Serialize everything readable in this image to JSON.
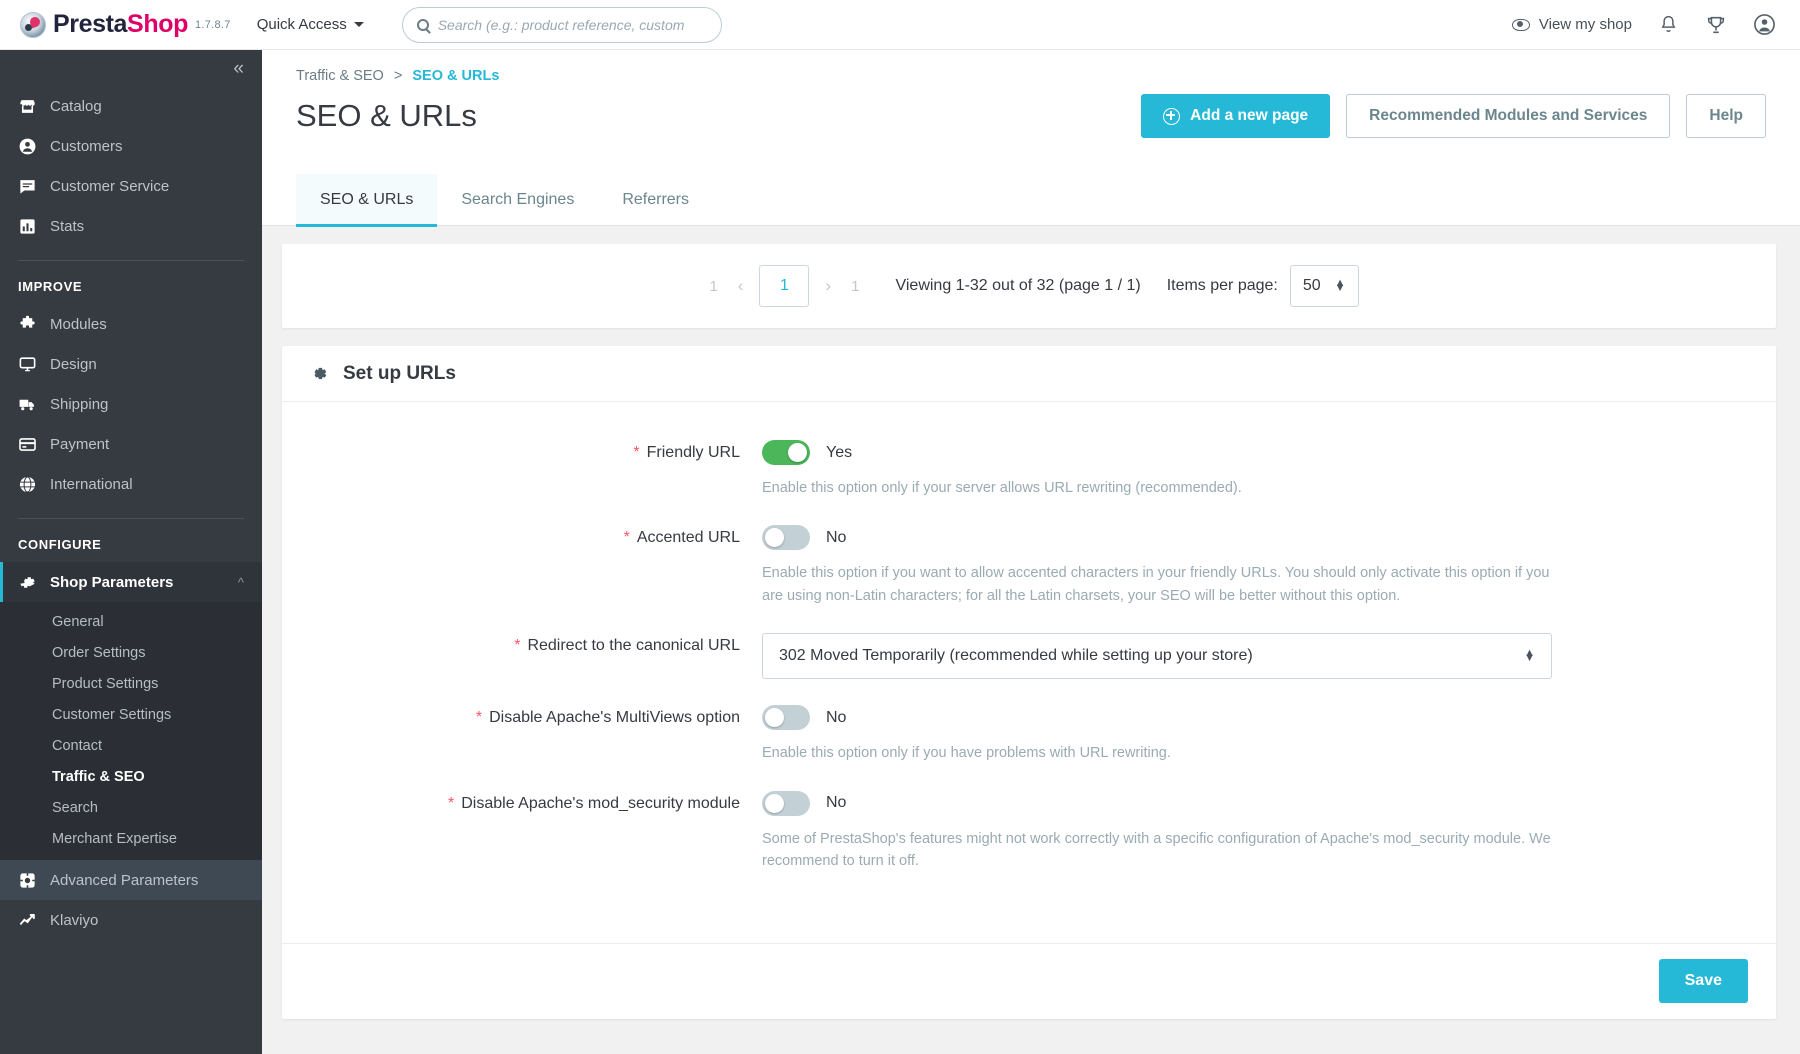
{
  "topbar": {
    "brand_a": "Presta",
    "brand_b": "Shop",
    "version": "1.7.8.7",
    "quick_access": "Quick Access",
    "search_placeholder": "Search (e.g.: product reference, custom",
    "search_value": "",
    "view_shop": "View my shop",
    "icons": [
      "eye-icon",
      "bell-icon",
      "trophy-icon",
      "account-icon"
    ]
  },
  "sidebar": {
    "collapse_glyph": "«",
    "groups": [
      {
        "title": null,
        "items": [
          {
            "label": "Catalog",
            "icon": "store-icon",
            "active": false
          },
          {
            "label": "Customers",
            "icon": "person-icon",
            "active": false
          },
          {
            "label": "Customer Service",
            "icon": "chat-icon",
            "active": false
          },
          {
            "label": "Stats",
            "icon": "bar-chart-icon",
            "active": false
          }
        ]
      },
      {
        "title": "IMPROVE",
        "items": [
          {
            "label": "Modules",
            "icon": "puzzle-icon",
            "active": false
          },
          {
            "label": "Design",
            "icon": "monitor-icon",
            "active": false
          },
          {
            "label": "Shipping",
            "icon": "truck-icon",
            "active": false
          },
          {
            "label": "Payment",
            "icon": "credit-card-icon",
            "active": false
          },
          {
            "label": "International",
            "icon": "globe-icon",
            "active": false
          }
        ]
      },
      {
        "title": "CONFIGURE",
        "items": [
          {
            "label": "Shop Parameters",
            "icon": "gear-icon",
            "active": true,
            "expanded": true
          },
          {
            "label": "Advanced Parameters",
            "icon": "sliders-icon",
            "active": false
          },
          {
            "label": "Klaviyo",
            "icon": "trend-icon",
            "active": false
          }
        ]
      }
    ],
    "submenu": [
      {
        "label": "General",
        "active": false
      },
      {
        "label": "Order Settings",
        "active": false
      },
      {
        "label": "Product Settings",
        "active": false
      },
      {
        "label": "Customer Settings",
        "active": false
      },
      {
        "label": "Contact",
        "active": false
      },
      {
        "label": "Traffic & SEO",
        "active": true
      },
      {
        "label": "Search",
        "active": false
      },
      {
        "label": "Merchant Expertise",
        "active": false
      }
    ]
  },
  "header": {
    "breadcrumb_parent": "Traffic & SEO",
    "breadcrumb_sep": ">",
    "breadcrumb_current": "SEO & URLs",
    "title": "SEO & URLs",
    "add_button": "Add a new page",
    "recommended_button": "Recommended Modules and Services",
    "help_button": "Help"
  },
  "tabs": [
    {
      "label": "SEO & URLs",
      "active": true
    },
    {
      "label": "Search Engines",
      "active": false
    },
    {
      "label": "Referrers",
      "active": false
    }
  ],
  "pagination": {
    "first": "1",
    "prev": "‹",
    "current": "1",
    "next": "›",
    "last": "1",
    "viewing": "Viewing 1-32 out of 32 (page 1 / 1)",
    "items_per_page_label": "Items per page:",
    "items_per_page_value": "50"
  },
  "panel": {
    "icon": "gear-icon",
    "title": "Set up URLs",
    "fields": [
      {
        "required": true,
        "label": "Friendly URL",
        "type": "toggle",
        "state": "on",
        "value_text": "Yes",
        "help": "Enable this option only if your server allows URL rewriting (recommended)."
      },
      {
        "required": true,
        "label": "Accented URL",
        "type": "toggle",
        "state": "off",
        "value_text": "No",
        "help": "Enable this option if you want to allow accented characters in your friendly URLs. You should only activate this option if you are using non-Latin characters; for all the Latin charsets, your SEO will be better without this option."
      },
      {
        "required": true,
        "label": "Redirect to the canonical URL",
        "type": "select",
        "value_text": "302 Moved Temporarily (recommended while setting up your store)",
        "help": ""
      },
      {
        "required": true,
        "label": "Disable Apache's MultiViews option",
        "type": "toggle",
        "state": "off",
        "value_text": "No",
        "help": "Enable this option only if you have problems with URL rewriting."
      },
      {
        "required": true,
        "label": "Disable Apache's mod_security module",
        "type": "toggle",
        "state": "off",
        "value_text": "No",
        "help": "Some of PrestaShop's features might not work correctly with a specific configuration of Apache's mod_security module. We recommend to turn it off."
      }
    ],
    "save_label": "Save"
  },
  "colors": {
    "accent": "#25b9d7",
    "sidebar": "#363a41",
    "toggle_on": "#4cb65a",
    "toggle_off": "#c3d1d6",
    "required_star": "#f9566b",
    "brand_pink": "#df0067"
  }
}
